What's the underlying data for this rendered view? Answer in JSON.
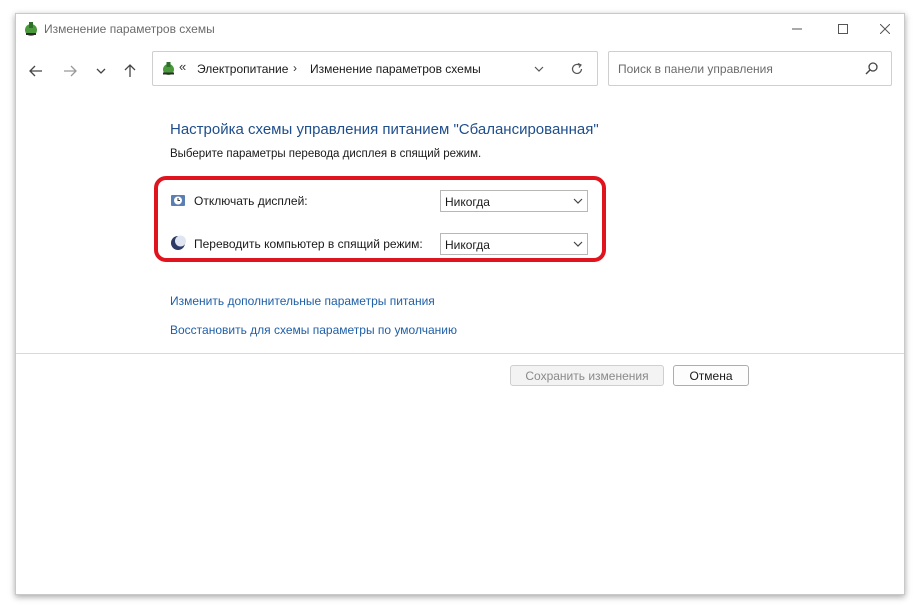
{
  "window": {
    "title": "Изменение параметров схемы",
    "icon": "power-options-icon"
  },
  "nav": {
    "address": {
      "crumbs": [
        "Электропитание",
        "Изменение параметров схемы"
      ],
      "separator": "›",
      "overflow": "«"
    },
    "search": {
      "placeholder": "Поиск в панели управления"
    }
  },
  "content": {
    "heading": "Настройка схемы управления питанием \"Сбалансированная\"",
    "subtext": "Выберите параметры перевода дисплея в спящий режим.",
    "settings": [
      {
        "label": "Отключать дисплей:",
        "value": "Никогда",
        "icon": "display-timer-icon"
      },
      {
        "label": "Переводить компьютер в спящий режим:",
        "value": "Никогда",
        "icon": "sleep-moon-icon"
      }
    ],
    "links": [
      "Изменить дополнительные параметры питания",
      "Восстановить для схемы параметры по умолчанию"
    ]
  },
  "buttons": {
    "save": {
      "label": "Сохранить изменения",
      "enabled": false
    },
    "cancel": {
      "label": "Отмена",
      "enabled": true
    }
  },
  "colors": {
    "heading": "#1f4e8c",
    "link": "#1f5fa8",
    "highlight": "#e0141e"
  }
}
